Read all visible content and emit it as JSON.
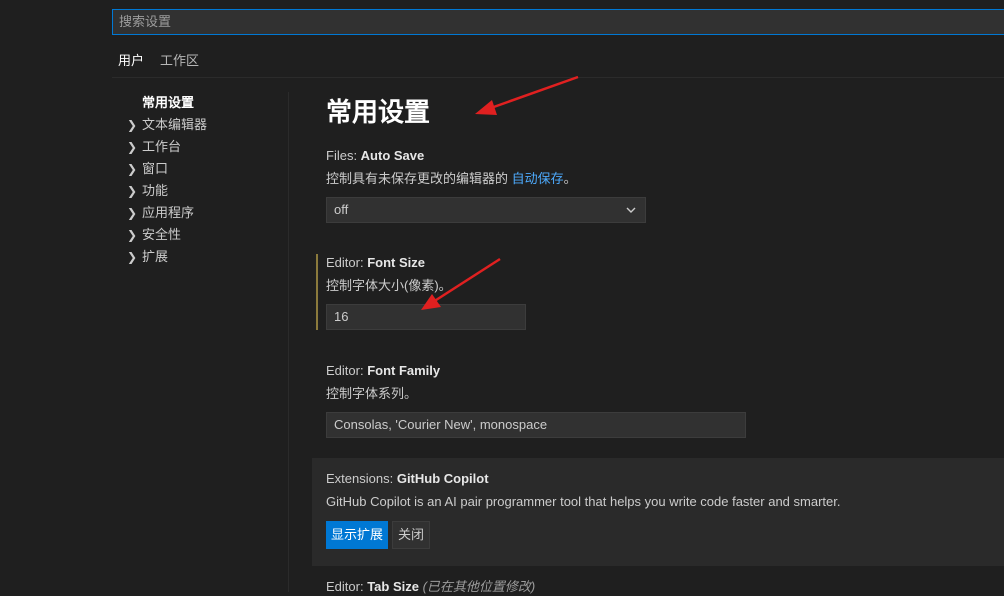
{
  "search": {
    "placeholder": "搜索设置"
  },
  "tabs": [
    {
      "label": "用户"
    },
    {
      "label": "工作区"
    }
  ],
  "toc": [
    {
      "label": "常用设置"
    },
    {
      "label": "文本编辑器"
    },
    {
      "label": "工作台"
    },
    {
      "label": "窗口"
    },
    {
      "label": "功能"
    },
    {
      "label": "应用程序"
    },
    {
      "label": "安全性"
    },
    {
      "label": "扩展"
    }
  ],
  "heading": "常用设置",
  "settings": {
    "auto_save": {
      "category": "Files: ",
      "name": "Auto Save",
      "desc_prefix": "控制具有未保存更改的编辑器的 ",
      "desc_link": "自动保存",
      "desc_suffix": "。",
      "value": "off"
    },
    "font_size": {
      "category": "Editor: ",
      "name": "Font Size",
      "desc": "控制字体大小(像素)。",
      "value": "16"
    },
    "font_family": {
      "category": "Editor: ",
      "name": "Font Family",
      "desc": "控制字体系列。",
      "value": "Consolas, 'Courier New', monospace"
    },
    "copilot": {
      "category": "Extensions: ",
      "name": "GitHub Copilot",
      "desc": "GitHub Copilot is an AI pair programmer tool that helps you write code faster and smarter.",
      "show_label": "显示扩展",
      "close_label": "关闭"
    },
    "tab_size": {
      "category": "Editor: ",
      "name": "Tab Size",
      "note": "(已在其他位置修改)"
    }
  },
  "colors": {
    "accent": "#0078d4",
    "link": "#4daafc",
    "annotation_arrow": "#e02020",
    "modified_indicator": "#8b7a3c"
  }
}
